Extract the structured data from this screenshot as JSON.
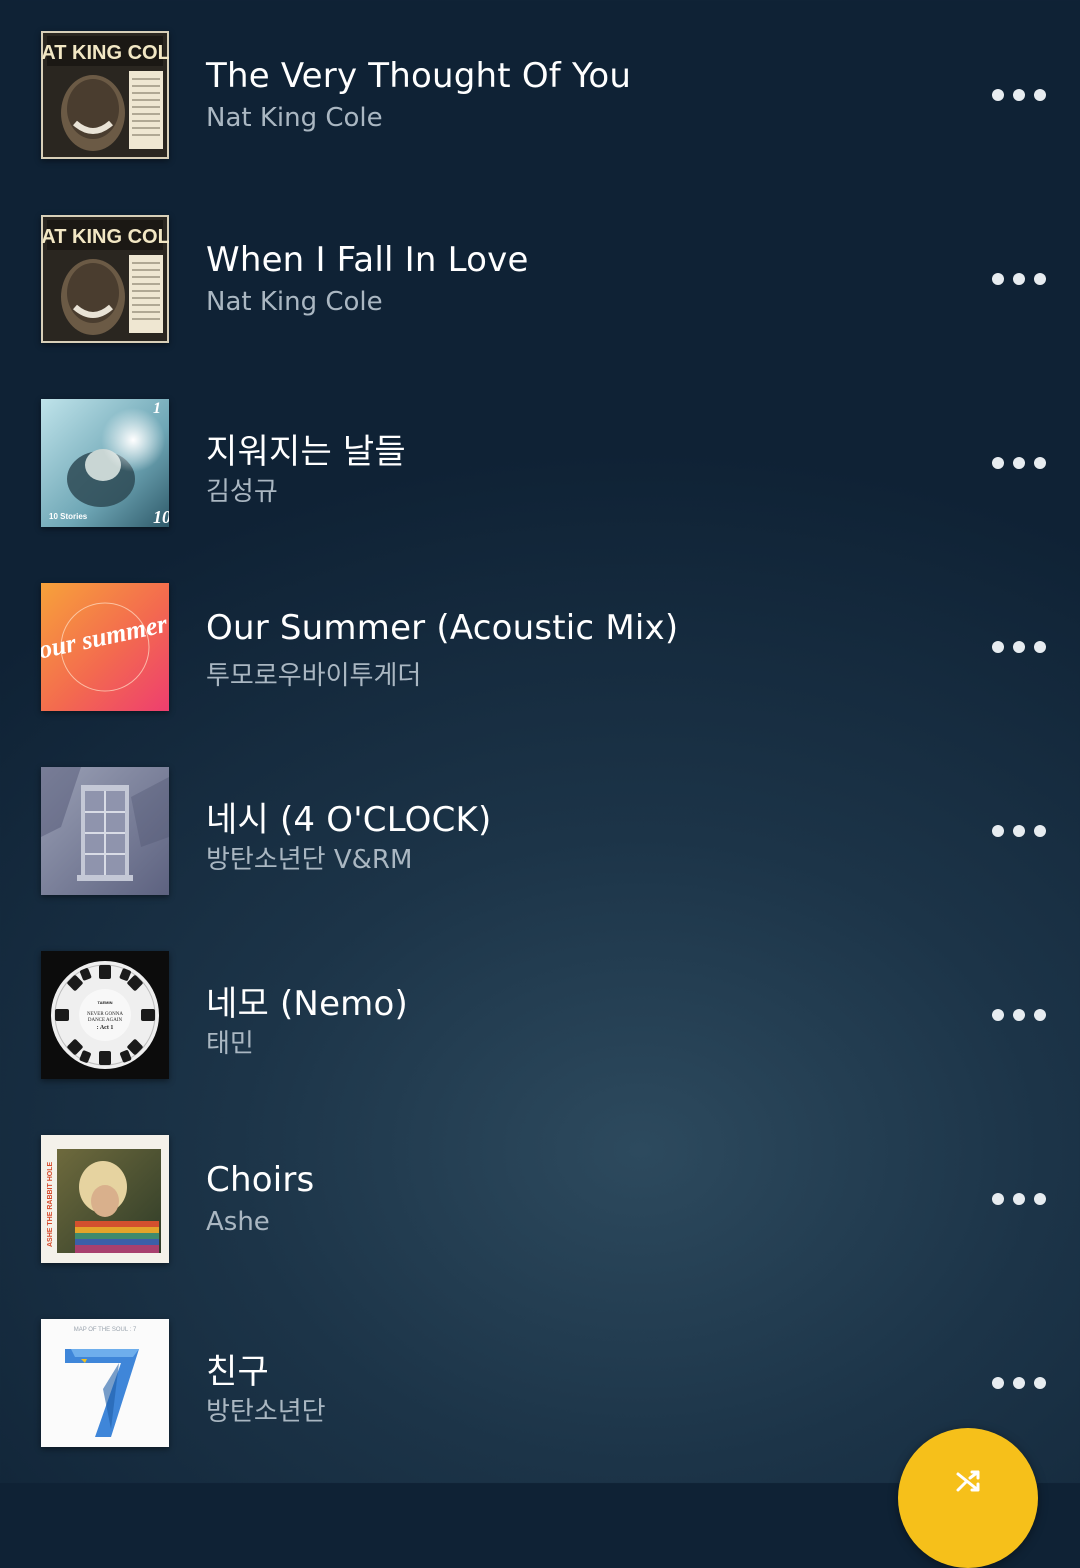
{
  "songs": [
    {
      "title": "The Very Thought Of You",
      "artist": "Nat King Cole",
      "art": "nat-king-cole-album-art",
      "art_text": "NAT KING COLE"
    },
    {
      "title": "When I Fall In Love",
      "artist": "Nat King Cole",
      "art": "nat-king-cole-album-art",
      "art_text": "NAT KING COLE"
    },
    {
      "title": "지워지는 날들",
      "artist": "김성규",
      "art": "10-stories-album-art",
      "art_text": "10 Stories"
    },
    {
      "title": "Our Summer (Acoustic Mix)",
      "artist": "투모로우바이투게더",
      "art": "our-summer-album-art",
      "art_text": "our summer"
    },
    {
      "title": "네시 (4 O'CLOCK)",
      "artist": "방탄소년단 V&RM",
      "art": "4-oclock-album-art",
      "art_text": ""
    },
    {
      "title": "네모 (Nemo)",
      "artist": "태민",
      "art": "never-gonna-dance-again-album-art",
      "art_text": "TAEMIN"
    },
    {
      "title": "Choirs",
      "artist": "Ashe",
      "art": "the-rabbit-hole-album-art",
      "art_text": "ASHE THE RABBIT HOLE"
    },
    {
      "title": "친구",
      "artist": "방탄소년단",
      "art": "map-of-the-soul-7-album-art",
      "art_text": "7"
    }
  ],
  "fab_icon": "shuffle-icon",
  "colors": {
    "background_top": "#0f2235",
    "title": "#ffffff",
    "artist": "#aab7c2",
    "fab": "#f6c01a"
  }
}
